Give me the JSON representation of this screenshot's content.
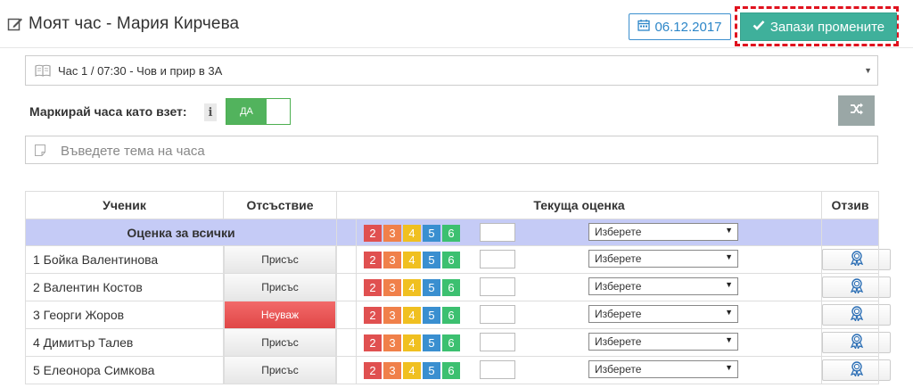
{
  "header": {
    "title": "Моят час - Мария Кирчева",
    "date": "06.12.2017",
    "save_label": "Запази промените"
  },
  "lesson": {
    "selected": "Час 1 / 07:30 - Чов и прир в 3А"
  },
  "mark_taken": {
    "label": "Маркирай часа като взет:",
    "toggle_label": "ДА",
    "toggle_on": true
  },
  "topic": {
    "placeholder": "Въведете тема на часа"
  },
  "table": {
    "columns": [
      "Ученик",
      "Отсъствие",
      "Текуща оценка",
      "Отзив"
    ],
    "all_label": "Оценка за всички",
    "grades": [
      "2",
      "3",
      "4",
      "5",
      "6"
    ],
    "grade_colors": [
      "#e05050",
      "#f0804a",
      "#f0c020",
      "#3a8fd0",
      "#3cc070"
    ],
    "select_placeholder": "Изберете",
    "rows": [
      {
        "name": "1 Бойка Валентинова",
        "absence": "Присъс",
        "absence_state": "present"
      },
      {
        "name": "2 Валентин Костов",
        "absence": "Присъс",
        "absence_state": "present"
      },
      {
        "name": "3 Георги Жоров",
        "absence": "Неуваж",
        "absence_state": "unexcused"
      },
      {
        "name": "4 Димитър Талев",
        "absence": "Присъс",
        "absence_state": "present"
      },
      {
        "name": "5 Елеонора Симкова",
        "absence": "Присъс",
        "absence_state": "present"
      }
    ]
  },
  "icons": [
    "edit-icon",
    "calendar-icon",
    "check-icon",
    "book-icon",
    "info-icon",
    "shuffle-icon",
    "note-icon",
    "award-icon"
  ],
  "colors": {
    "accent_teal": "#3fb09b",
    "date_blue": "#2c86c8",
    "highlight_red": "#e0121e",
    "toggle_green": "#52b35d",
    "all_row_bg": "#c5cbf6",
    "unexcused_red": "#e04646"
  }
}
